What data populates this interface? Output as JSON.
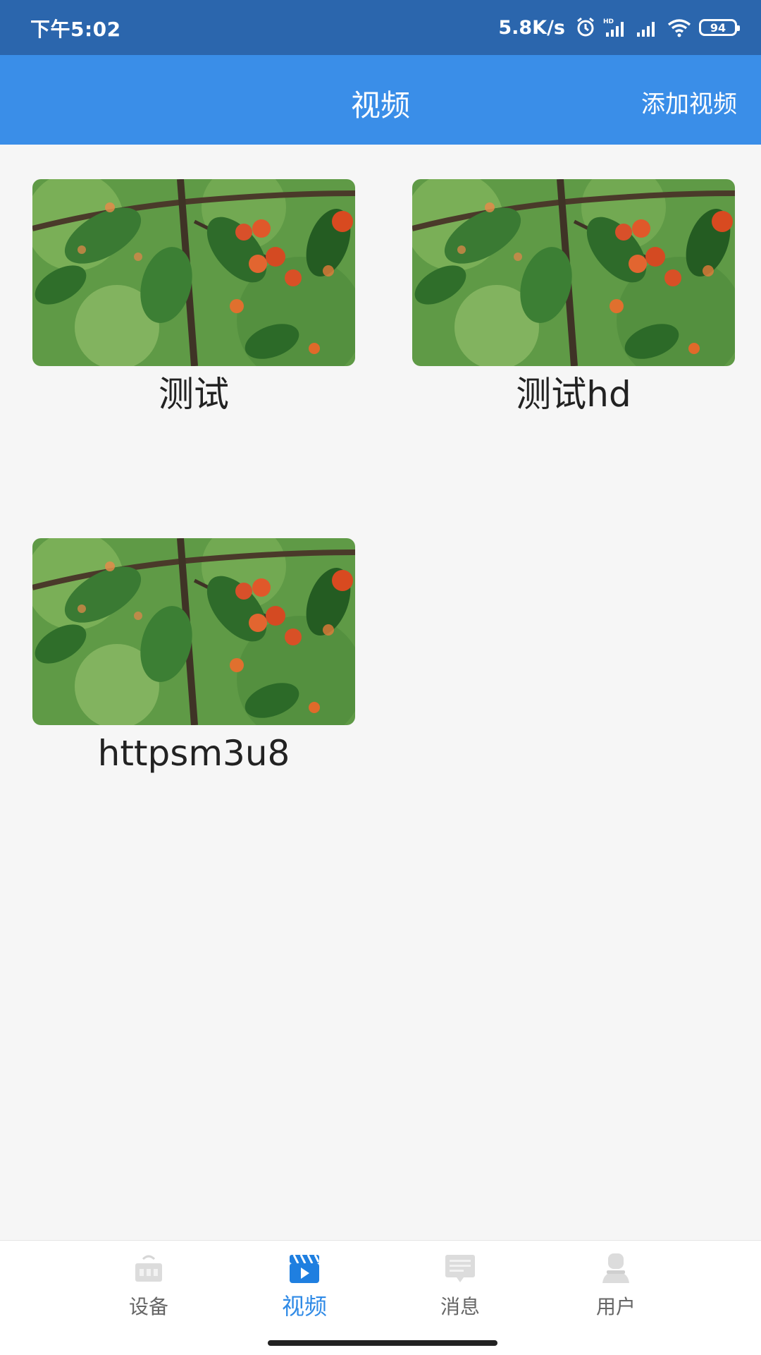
{
  "status_bar": {
    "time": "下午5:02",
    "net_speed": "5.8K/s",
    "battery": "94"
  },
  "app_bar": {
    "title": "视频",
    "add_action": "添加视频"
  },
  "videos": [
    {
      "title": "测试"
    },
    {
      "title": "测试hd"
    },
    {
      "title": "httpsm3u8"
    }
  ],
  "bottom_nav": {
    "items": [
      {
        "label": "设备",
        "icon": "device-icon"
      },
      {
        "label": "视频",
        "icon": "video-icon",
        "active": true
      },
      {
        "label": "消息",
        "icon": "message-icon"
      },
      {
        "label": "用户",
        "icon": "user-icon"
      }
    ]
  },
  "colors": {
    "status_bar": "#2b66ad",
    "app_bar": "#3a8ee8",
    "accent": "#2f8ae6"
  }
}
